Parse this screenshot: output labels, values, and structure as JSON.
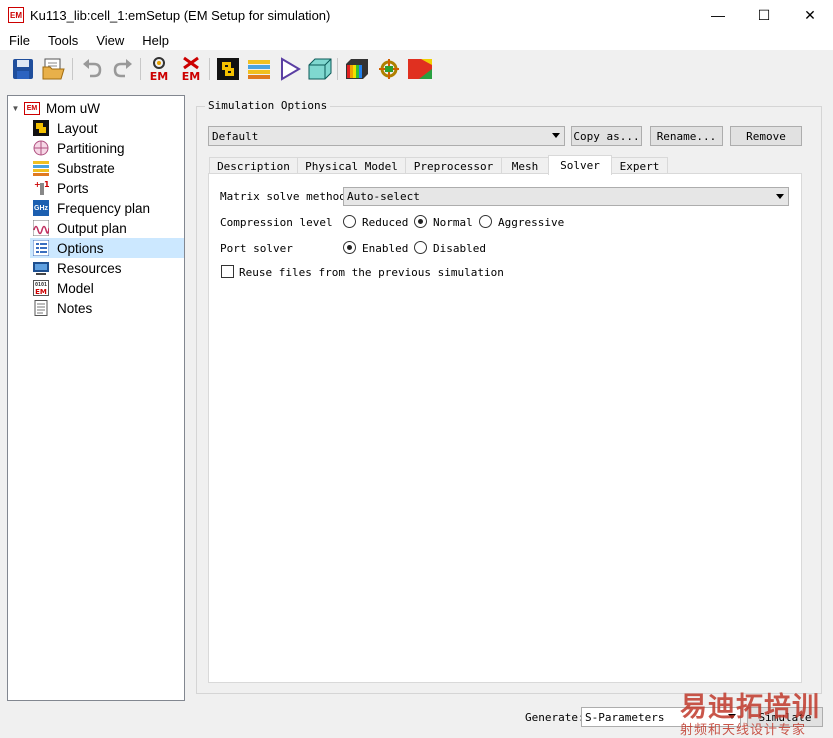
{
  "window": {
    "app_icon_text": "EM",
    "title": "Ku113_lib:cell_1:emSetup (EM Setup for simulation)",
    "minimize": "—",
    "maximize": "☐",
    "close": "✕"
  },
  "menu": [
    "File",
    "Tools",
    "View",
    "Help"
  ],
  "toolbar": {
    "icons": [
      "save-icon",
      "open-icon",
      "undo-icon",
      "redo-icon",
      "em-simulate-icon",
      "em-stop-icon",
      "layout-icon",
      "substrate-icon",
      "schematic-symbol-icon",
      "3d-view-icon",
      "visualization-icon",
      "mesh-icon",
      "field-plot-icon"
    ],
    "em_label": "EM"
  },
  "tree": {
    "root_label": "Mom uW",
    "root_badge": "EM",
    "items": [
      {
        "label": "Layout",
        "icon": "layout-icon",
        "glyph": "▙"
      },
      {
        "label": "Partitioning",
        "icon": "partitioning-icon",
        "glyph": "◎"
      },
      {
        "label": "Substrate",
        "icon": "substrate-icon",
        "glyph": "▤"
      },
      {
        "label": "Ports",
        "icon": "ports-icon",
        "glyph": "±"
      },
      {
        "label": "Frequency plan",
        "icon": "ghz-icon",
        "glyph": "GHz"
      },
      {
        "label": "Output plan",
        "icon": "output-plan-icon",
        "glyph": "∿"
      },
      {
        "label": "Options",
        "icon": "options-icon",
        "glyph": "☰"
      },
      {
        "label": "Resources",
        "icon": "resources-icon",
        "glyph": "▬"
      },
      {
        "label": "Model",
        "icon": "model-icon",
        "glyph": "EM"
      },
      {
        "label": "Notes",
        "icon": "notes-icon",
        "glyph": "≡"
      }
    ],
    "selected_index": 6
  },
  "main": {
    "group_title": "Simulation Options",
    "preset_value": "Default",
    "buttons": {
      "copy": "Copy as...",
      "rename": "Rename...",
      "remove": "Remove"
    },
    "tabs": [
      "Description",
      "Physical Model",
      "Preprocessor",
      "Mesh",
      "Solver",
      "Expert"
    ],
    "active_tab": "Solver",
    "solver": {
      "matrix_label": "Matrix solve method",
      "matrix_value": "Auto-select",
      "compression_label": "Compression level",
      "compression_options": [
        "Reduced",
        "Normal",
        "Aggressive"
      ],
      "compression_selected": "Normal",
      "port_label": "Port solver",
      "port_options": [
        "Enabled",
        "Disabled"
      ],
      "port_selected": "Enabled",
      "reuse_label": "Reuse files from the previous simulation",
      "reuse_checked": false
    }
  },
  "bottom": {
    "generate_label": "Generate:",
    "generate_value": "S-Parameters",
    "simulate_label": "Simulate"
  },
  "watermark": {
    "big": "易迪拓培训",
    "small": "射频和天线设计专家"
  },
  "colors": {
    "selection": "#cce8ff",
    "em_red": "#cc0000",
    "watermark": "#c0392b"
  }
}
